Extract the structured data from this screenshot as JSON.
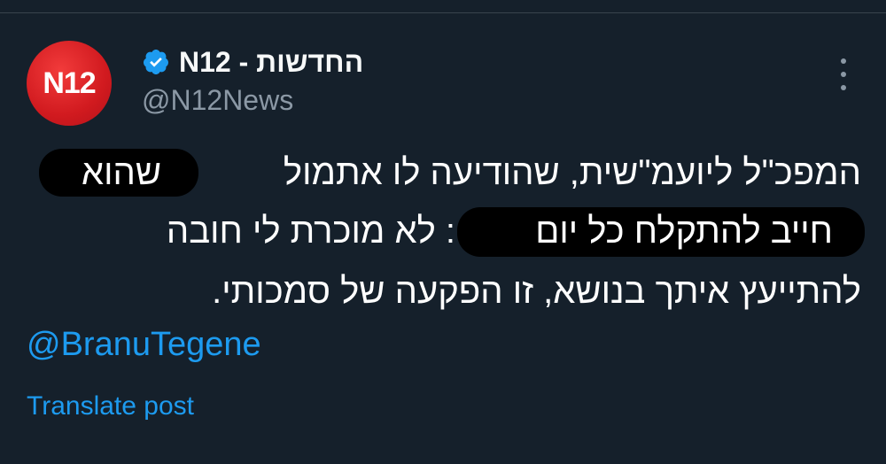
{
  "account": {
    "avatar_text": "N12",
    "display_name": "החדשות - N12",
    "handle": "@N12News",
    "verified_color": "#1d9bf0"
  },
  "tweet": {
    "line1": "המפכ\"ל ליועמ\"שית, שהודיעה לו אתמול",
    "line1_redacted_word": "שהוא",
    "line2_redacted": "חייב להתקלח כל יום",
    "line2_rest": ": לא מוכרת לי חובה",
    "line3": "להתייעץ איתך בנושא, זו הפקעה של סמכותי."
  },
  "mention": "@BranuTegene",
  "translate_label": "Translate post",
  "more_icon": "more-vertical-icon",
  "colors": {
    "background": "#15202b",
    "text": "#f7f9f9",
    "muted": "#8b98a5",
    "accent": "#1d9bf0",
    "avatar_red": "#d11a1f"
  }
}
